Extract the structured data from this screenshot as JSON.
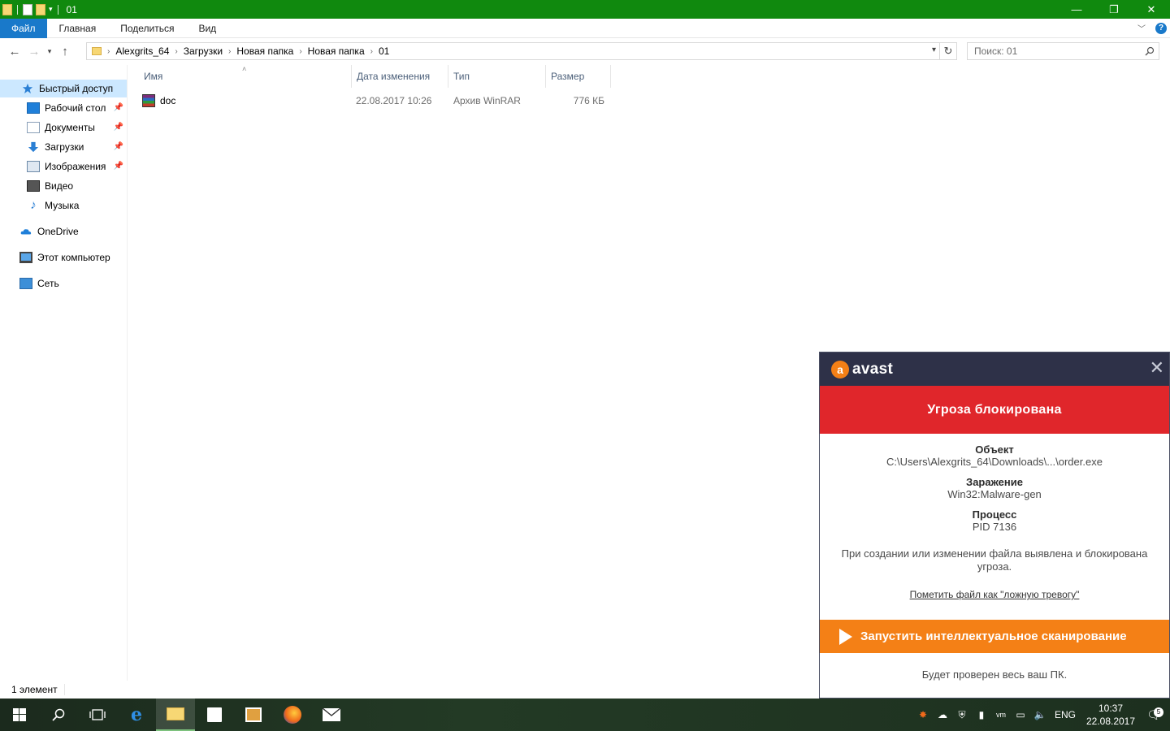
{
  "window": {
    "title": "01",
    "controls": [
      "—",
      "❐",
      "✕"
    ]
  },
  "ribbon": {
    "tabs": [
      "Файл",
      "Главная",
      "Поделиться",
      "Вид"
    ],
    "help": "?"
  },
  "address": {
    "crumbs": [
      "Alexgrits_64",
      "Загрузки",
      "Новая папка",
      "Новая папка",
      "01"
    ],
    "search_placeholder": "Поиск: 01"
  },
  "nav": {
    "quick_access": "Быстрый доступ",
    "items": [
      "Рабочий стол",
      "Документы",
      "Загрузки",
      "Изображения",
      "Видео",
      "Музыка"
    ],
    "onedrive": "OneDrive",
    "this_pc": "Этот компьютер",
    "network": "Сеть"
  },
  "columns": [
    "Имя",
    "Дата изменения",
    "Тип",
    "Размер"
  ],
  "files": [
    {
      "name": "doc",
      "date": "22.08.2017 10:26",
      "type": "Архив WinRAR",
      "size": "776 КБ"
    }
  ],
  "status": {
    "count": "1 элемент"
  },
  "taskbar": {
    "lang": "ENG",
    "time": "10:37",
    "date": "22.08.2017",
    "notifications": "5"
  },
  "avast": {
    "brand": "avast",
    "logo_letter": "a",
    "header": "Угроза блокирована",
    "object_label": "Объект",
    "object_value": "C:\\Users\\Alexgrits_64\\Downloads\\...\\order.exe",
    "infection_label": "Заражение",
    "infection_value": "Win32:Malware-gen",
    "process_label": "Процесс",
    "process_value": "PID 7136",
    "message": "При создании или изменении файла выявлена и блокирована угроза.",
    "false_alarm_link": "Пометить файл как \"ложную тревогу\"",
    "scan_button": "Запустить интеллектуальное сканирование",
    "footer": "Будет проверен весь ваш ПК.",
    "accent": "#f48016",
    "alert": "#e0262b"
  }
}
